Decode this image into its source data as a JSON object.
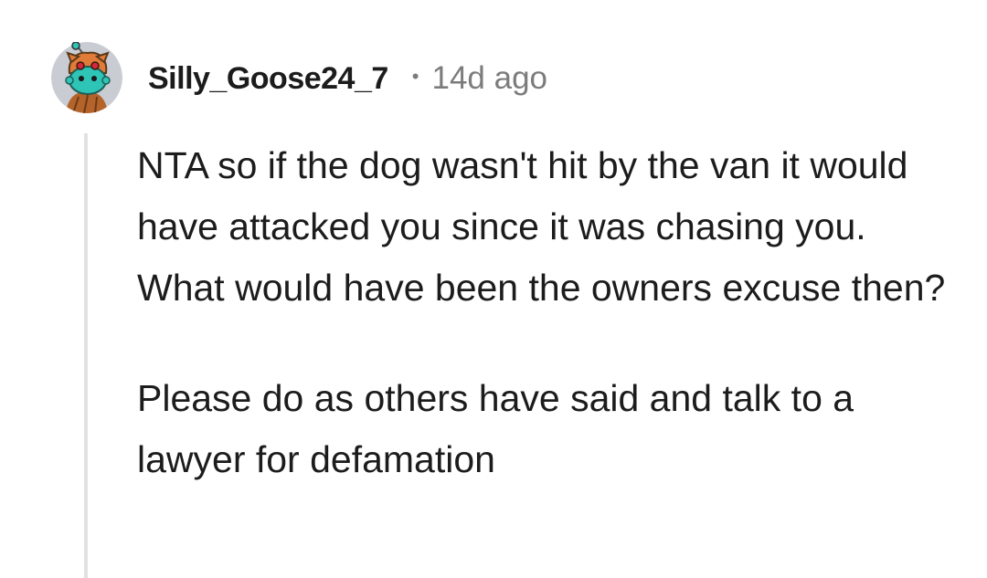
{
  "comment": {
    "author": "Silly_Goose24_7",
    "separator": "•",
    "timestamp": "14d ago",
    "avatar_icon": "snoo-avatar-icon",
    "paragraphs": [
      "NTA so if the dog wasn't hit by the van it would have attacked you since it was chasing you. What would have been the owners excuse then?",
      "Please do as others have said and talk to a lawyer for defamation"
    ]
  },
  "colors": {
    "text": "#1c1c1c",
    "meta": "#7c7c7c",
    "thread_line": "#e1e1e1",
    "avatar_bg": "#c9ccd2",
    "avatar_face": "#2ec4b6",
    "avatar_hat": "#e07b39"
  }
}
